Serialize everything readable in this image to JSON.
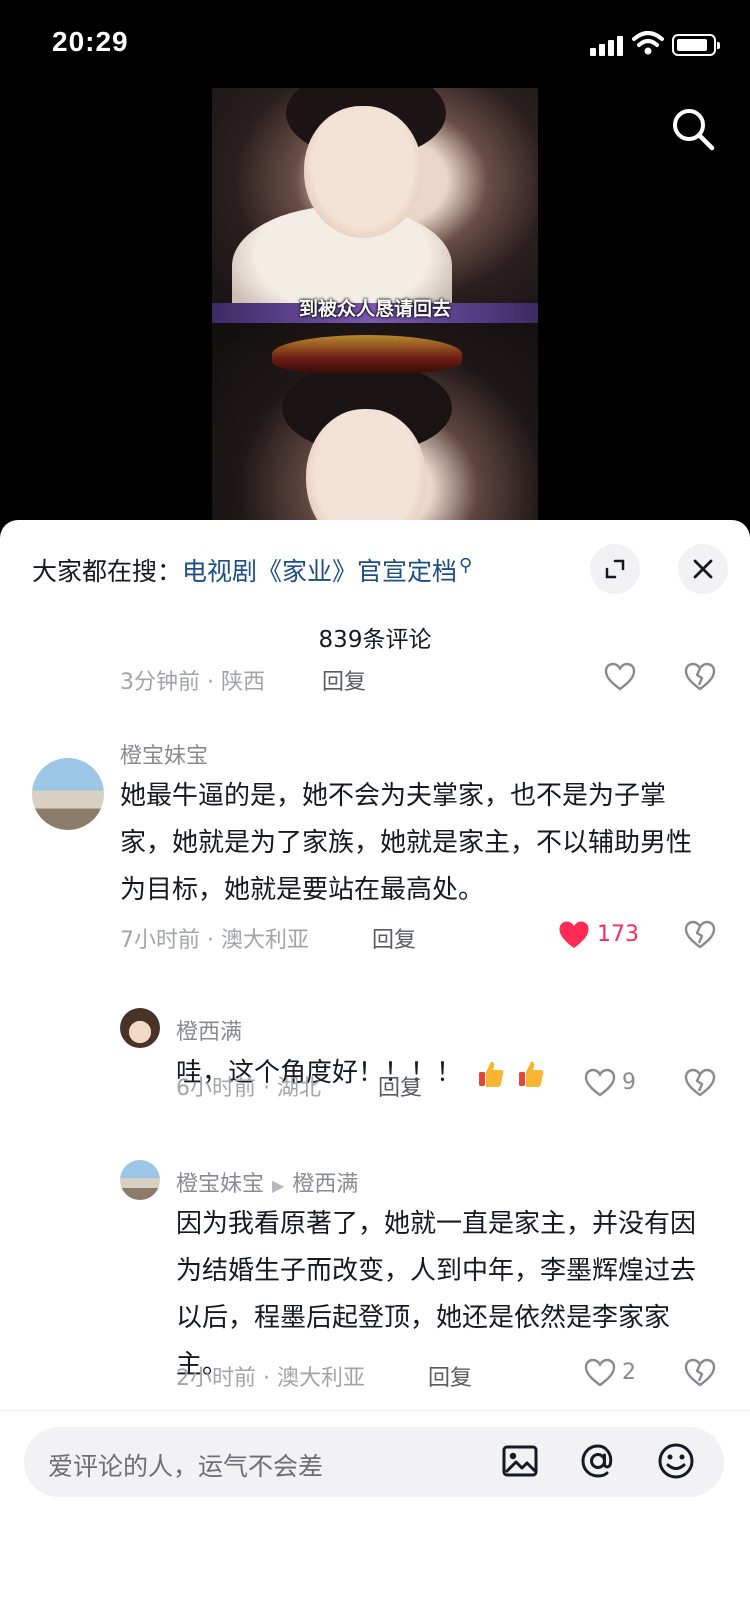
{
  "status_bar": {
    "time": "20:29"
  },
  "video": {
    "subtitle": "到被众人恳请回去"
  },
  "header": {
    "hot_search_prefix": "大家都在搜：",
    "hot_search_link": "电视剧《家业》官宣定档",
    "comment_count": "839条评论"
  },
  "comments": [
    {
      "meta": "3分钟前 · 陕西",
      "reply_label": "回复"
    },
    {
      "username": "橙宝妹宝",
      "text": "她最牛逼的是，她不会为夫掌家，也不是为子掌家，她就是为了家族，她就是家主，不以辅助男性为目标，她就是要站在最高处。",
      "meta": "7小时前 · 澳大利亚",
      "reply_label": "回复",
      "likes": "173",
      "liked": true
    },
    {
      "username": "橙西满",
      "text": "哇，这个角度好！！！！",
      "meta": "6小时前 · 湖北",
      "reply_label": "回复",
      "likes": "9"
    },
    {
      "username": "橙宝妹宝",
      "reply_to": "橙西满",
      "text": "因为我看原著了，她就一直是家主，并没有因为结婚生子而改变，人到中年，李墨辉煌过去以后，程墨后起登顶，她还是依然是李家家主。",
      "meta": "2小时前 · 澳大利亚",
      "reply_label": "回复",
      "likes": "2"
    }
  ],
  "input": {
    "placeholder": "爱评论的人，运气不会差"
  },
  "colors": {
    "accent_red": "#fe2c55",
    "link_blue": "#1d4d8a"
  }
}
